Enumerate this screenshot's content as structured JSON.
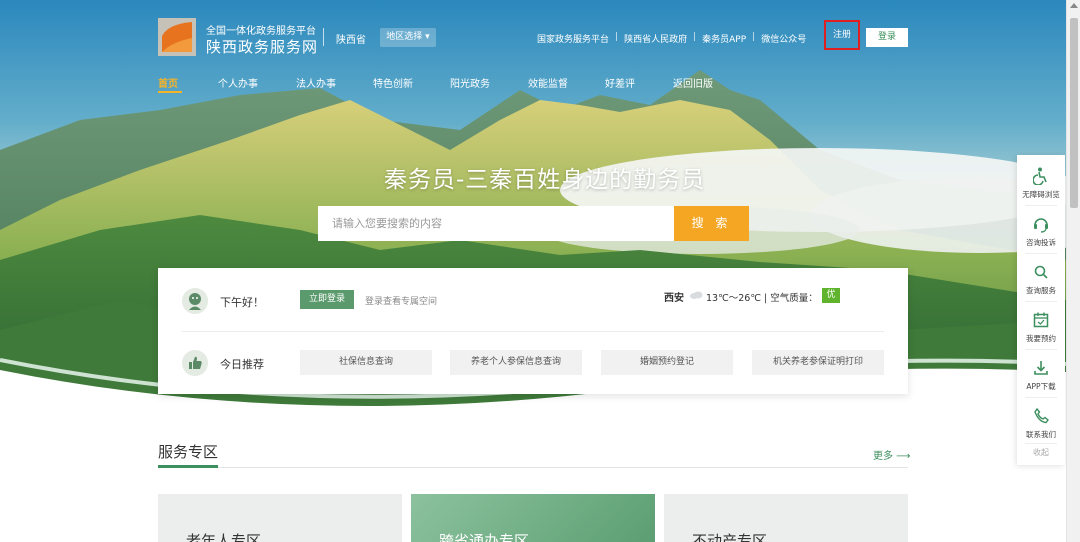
{
  "header": {
    "platform_subtitle": "全国一体化政务服务平台",
    "site_title": "陕西政务服务网",
    "province": "陕西省",
    "region_select": "地区选择",
    "links": [
      "国家政务服务平台",
      "陕西省人民政府",
      "秦务员APP",
      "微信公众号"
    ],
    "register": "注册",
    "login": "登录"
  },
  "nav": {
    "items": [
      "首页",
      "个人办事",
      "法人办事",
      "特色创新",
      "阳光政务",
      "效能监督",
      "好差评",
      "返回旧版"
    ],
    "active_index": 0
  },
  "hero": {
    "slogan": "秦务员-三秦百姓身边的勤务员",
    "search_placeholder": "请输入您要搜索的内容",
    "search_button": "搜 索"
  },
  "info_card": {
    "greeting": "下午好！",
    "login_now": "立即登录",
    "login_hint": "登录查看专属空间",
    "weather": {
      "city": "西安",
      "temperature": "13℃～26℃",
      "air_quality_label": "| 空气质量：",
      "air_quality_value": "优"
    },
    "recommend_label": "今日推荐",
    "recommendations": [
      "社保信息查询",
      "养老个人参保信息查询",
      "婚姻预约登记",
      "机关养老参保证明打印"
    ]
  },
  "services": {
    "title": "服务专区",
    "more": "更多 ⟶",
    "tiles": [
      "老年人专区",
      "跨省通办专区",
      "不动产专区"
    ]
  },
  "sidebar": {
    "items": [
      {
        "label": "无障碍浏览",
        "icon": "wheelchair-icon"
      },
      {
        "label": "咨询投诉",
        "icon": "headset-icon"
      },
      {
        "label": "查询服务",
        "icon": "search-icon"
      },
      {
        "label": "我要预约",
        "icon": "calendar-icon"
      },
      {
        "label": "APP下载",
        "icon": "download-icon"
      },
      {
        "label": "联系我们",
        "icon": "phone-icon"
      }
    ],
    "collapse": "收起"
  },
  "colors": {
    "accent_green": "#3c8f5e",
    "search_orange": "#f5a623",
    "nav_active": "#f5b327",
    "register_highlight": "#e02020"
  }
}
